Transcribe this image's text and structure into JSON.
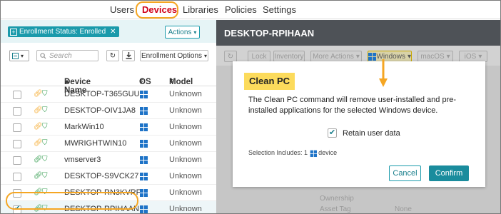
{
  "nav": {
    "items": [
      "Users",
      "Devices",
      "Libraries",
      "Policies",
      "Settings"
    ],
    "active": "Devices"
  },
  "filter": {
    "chip_label": "Enrollment Status: Enrolled",
    "actions_label": "Actions"
  },
  "toolbar": {
    "search_placeholder": "Search",
    "enrollment_options_label": "Enrollment Options"
  },
  "table": {
    "columns": [
      "Device Name",
      "OS",
      "Model"
    ],
    "rows": [
      {
        "name": "DESKTOP-T365GUU",
        "model": "Unknown",
        "link_color": "#f5a623",
        "checked": false
      },
      {
        "name": "DESKTOP-OIV1JA8",
        "model": "Unknown",
        "link_color": "#f5a623",
        "checked": false
      },
      {
        "name": "MarkWin10",
        "model": "Unknown",
        "link_color": "#f5a623",
        "checked": false
      },
      {
        "name": "MWRIGHTWIN10",
        "model": "Unknown",
        "link_color": "#f5a623",
        "checked": false
      },
      {
        "name": "vmserver3",
        "model": "Unknown",
        "link_color": "#2e9a4a",
        "checked": false
      },
      {
        "name": "DESKTOP-S9VCK27",
        "model": "Unknown",
        "link_color": "#2e9a4a",
        "checked": false
      },
      {
        "name": "DESKTOP-RN3KVRF",
        "model": "Unknown",
        "link_color": "#2e9a4a",
        "checked": false
      },
      {
        "name": "DESKTOP-RPIHAAN",
        "model": "Unknown",
        "link_color": "#2e9a4a",
        "checked": true
      }
    ]
  },
  "detail": {
    "title": "DESKTOP-RPIHAAN",
    "toolbar": [
      "Lock",
      "Inventory",
      "More Actions",
      "Windows",
      "macOS",
      "iOS"
    ],
    "ghost_labels": [
      "Ownership",
      "Asset Tag",
      "None"
    ]
  },
  "modal": {
    "title": "Clean PC",
    "body": "The Clean PC command will remove user-installed and pre-installed applications for the selected Windows device.",
    "retain_label": "Retain user data",
    "selection_prefix": "Selection Includes: 1",
    "selection_suffix": "device",
    "cancel_label": "Cancel",
    "confirm_label": "Confirm"
  },
  "colors": {
    "accent": "#1a9aab",
    "highlight": "#f5a623",
    "active_nav": "#d0021b",
    "modal_title_bg": "#fcdb5c"
  }
}
